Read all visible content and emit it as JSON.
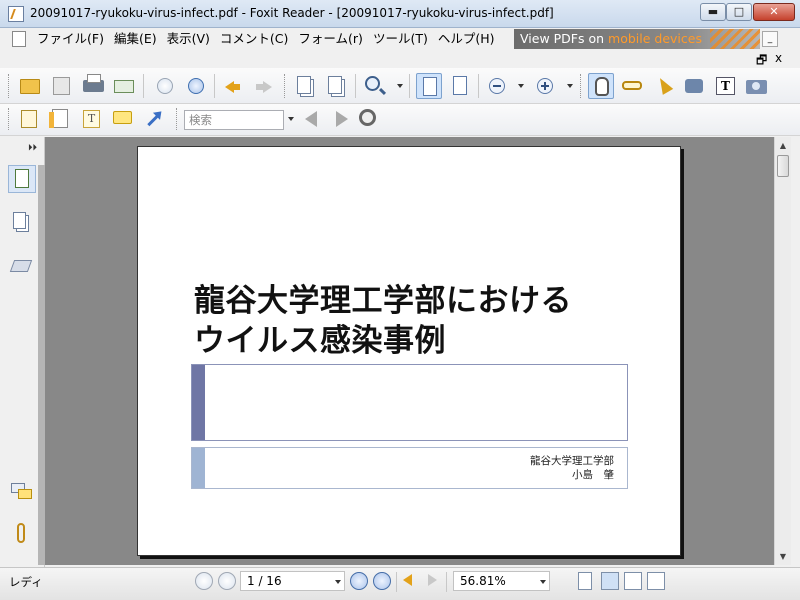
{
  "window": {
    "title": "20091017-ryukoku-virus-infect.pdf - Foxit Reader - [20091017-ryukoku-virus-infect.pdf]",
    "min_glyph": "▬",
    "max_glyph": "□",
    "close_glyph": "✕"
  },
  "menu": {
    "items": [
      "ファイル(F)",
      "編集(E)",
      "表示(V)",
      "コメント(C)",
      "フォーム(r)",
      "ツール(T)",
      "ヘルプ(H)"
    ],
    "banner_prefix": "View PDFs on ",
    "banner_highlight": "mobile devices",
    "mdi_min": "_",
    "mdi_restore": "🗗",
    "mdi_close": "x"
  },
  "toolbar": {
    "search_placeholder": "検索"
  },
  "document": {
    "title_line1": "龍谷大学理工学部における",
    "title_line2": "ウイルス感染事例",
    "affiliation": "龍谷大学理工学部",
    "author": "小島　肇"
  },
  "status": {
    "text": "レディ",
    "page_indicator": "1 / 16",
    "zoom": "56.81%"
  },
  "scroll": {
    "up_glyph": "▲",
    "down_glyph": "▼"
  },
  "sidebar": {
    "collapse_glyph": "⏵⏵"
  }
}
